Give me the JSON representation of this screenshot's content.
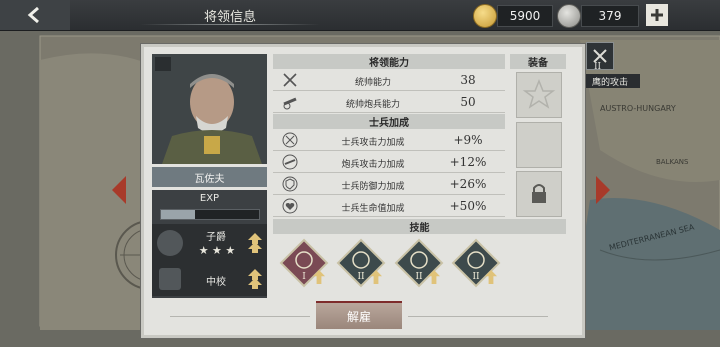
{
  "header": {
    "title": "将领信息",
    "gold_amount": "5900",
    "medal_amount": "379"
  },
  "map_labels": {
    "map_unit_label": "鹰的攻击",
    "map_unit_level": "II",
    "austro_hungary": "AUSTRO-HUNGARY",
    "balkans": "BALKANS",
    "mediterranean": "MEDITERRANEAN SEA"
  },
  "general": {
    "name": "瓦佐夫",
    "exp_label": "EXP",
    "exp_progress": 0.35,
    "title_rank": "子爵",
    "title_stars": 3,
    "military_rank": "中校"
  },
  "ability": {
    "header": "将领能力",
    "rows": [
      {
        "label": "统帅能力",
        "value": "38",
        "icon": "crossed-swords-icon"
      },
      {
        "label": "统帅炮兵能力",
        "value": "50",
        "icon": "cannon-icon"
      }
    ]
  },
  "soldier": {
    "header": "士兵加成",
    "rows": [
      {
        "label": "士兵攻击力加成",
        "value": "+9%",
        "icon": "attack-icon"
      },
      {
        "label": "炮兵攻击力加成",
        "value": "+12%",
        "icon": "artillery-icon"
      },
      {
        "label": "士兵防御力加成",
        "value": "+26%",
        "icon": "defense-icon"
      },
      {
        "label": "士兵生命值加成",
        "value": "+50%",
        "icon": "health-icon"
      }
    ]
  },
  "equipment": {
    "header": "装备"
  },
  "skills": {
    "header": "技能",
    "items": [
      {
        "level": "I",
        "icon": "arrows-skill-icon",
        "color": "#7a4a54"
      },
      {
        "level": "II",
        "icon": "horse-skill-icon",
        "color": "#3d4a4c"
      },
      {
        "level": "II",
        "icon": "shield-skill-icon",
        "color": "#3d4a4c"
      },
      {
        "level": "II",
        "icon": "trees-skill-icon",
        "color": "#3d4a4c"
      }
    ]
  },
  "actions": {
    "dismiss_label": "解雇"
  }
}
